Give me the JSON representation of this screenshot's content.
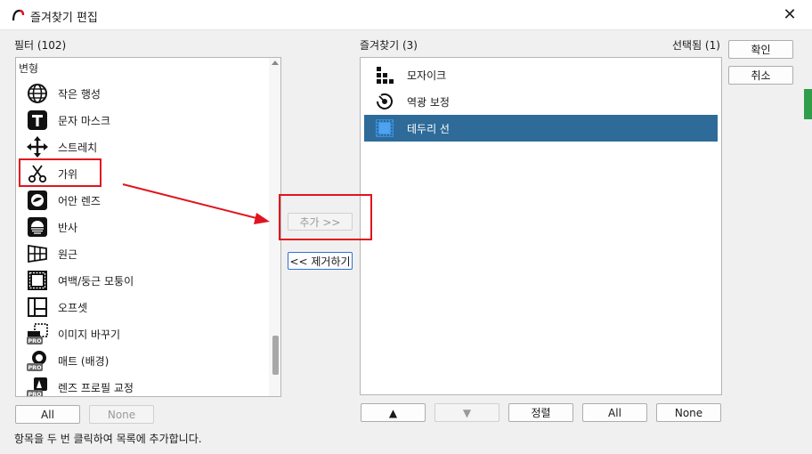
{
  "window": {
    "title": "즐겨찾기 편집",
    "close_label": "✕"
  },
  "left": {
    "label": "필터 (102)",
    "group_header": "변형",
    "items": [
      {
        "label": "작은 행성",
        "icon": "globe-icon",
        "pro": false
      },
      {
        "label": "문자 마스크",
        "icon": "text-mask-icon",
        "pro": false
      },
      {
        "label": "스트레치",
        "icon": "move-arrows-icon",
        "pro": false
      },
      {
        "label": "가위",
        "icon": "scissors-icon",
        "pro": false
      },
      {
        "label": "어안 렌즈",
        "icon": "fisheye-icon",
        "pro": false
      },
      {
        "label": "반사",
        "icon": "reflection-icon",
        "pro": false
      },
      {
        "label": "원근",
        "icon": "perspective-grid-icon",
        "pro": false
      },
      {
        "label": "여백/둥근 모퉁이",
        "icon": "margin-frame-icon",
        "pro": false
      },
      {
        "label": "오프셋",
        "icon": "offset-icon",
        "pro": false
      },
      {
        "label": "이미지 바꾸기",
        "icon": "replace-image-icon",
        "pro": true
      },
      {
        "label": "매트 (배경)",
        "icon": "matte-icon",
        "pro": true
      },
      {
        "label": "렌즈 프로필 교정",
        "icon": "lens-profile-icon",
        "pro": true
      }
    ],
    "pro_badge": "PRO",
    "all_button": "All",
    "none_button": "None"
  },
  "middle": {
    "add_button": "추가 >>",
    "remove_button": "<< 제거하기"
  },
  "right": {
    "label": "즐겨찾기 (3)",
    "selected_label": "선택됨 (1)",
    "items": [
      {
        "label": "모자이크",
        "icon": "mosaic-icon",
        "selected": false
      },
      {
        "label": "역광 보정",
        "icon": "backlight-icon",
        "selected": false
      },
      {
        "label": "테두리 선",
        "icon": "border-line-icon",
        "selected": true
      }
    ],
    "up_button": "▲",
    "down_button": "▼",
    "sort_button": "정렬",
    "all_button": "All",
    "none_button": "None"
  },
  "dialog": {
    "ok_button": "확인",
    "cancel_button": "취소"
  },
  "status": {
    "hint": "항목을 두 번 클릭하여 목록에 추가합니다."
  },
  "colors": {
    "selection": "#2e6b99",
    "annotation": "#e0141e",
    "focus": "#2f6fd6"
  }
}
